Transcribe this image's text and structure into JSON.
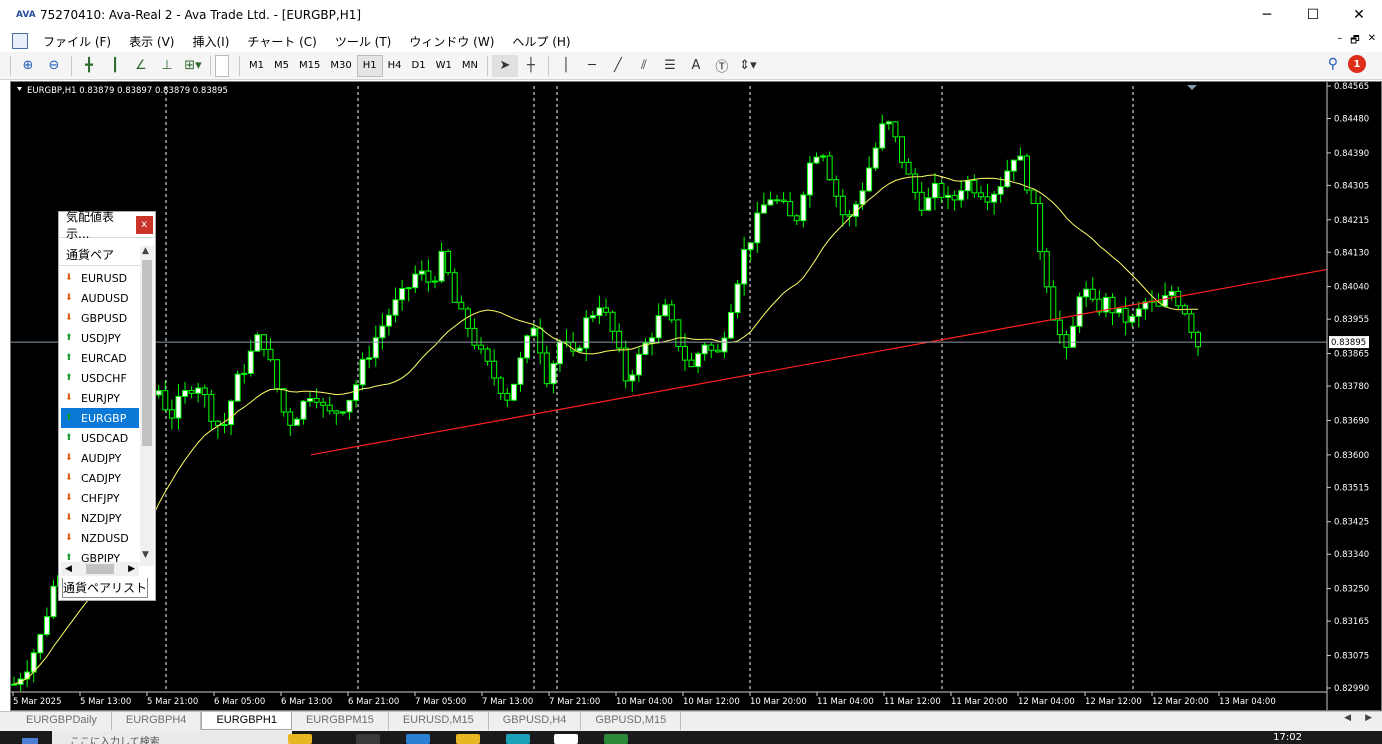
{
  "window": {
    "title": "75270410: Ava-Real 2 - Ava Trade Ltd. - [EURGBP,H1]",
    "logo": "AVA",
    "min": "─",
    "max": "☐",
    "close": "✕"
  },
  "menu": {
    "items": [
      "ファイル (F)",
      "表示 (V)",
      "挿入(I)",
      "チャート (C)",
      "ツール (T)",
      "ウィンドウ (W)",
      "ヘルプ (H)"
    ],
    "mdi": [
      "–",
      "🗗",
      "✕"
    ]
  },
  "toolbar": {
    "timeframes": [
      "M1",
      "M5",
      "M15",
      "M30",
      "H1",
      "H4",
      "D1",
      "W1",
      "MN"
    ],
    "active_timeframe": "H1",
    "tools": [
      "zoom-in-icon",
      "zoom-out-icon",
      "bar-chart-icon",
      "candle-icon",
      "line-chart-icon",
      "chart-shift-icon",
      "add-indicator-icon",
      "cursor-icon",
      "crosshair-icon",
      "vertical-line-icon",
      "horizontal-line-icon",
      "trend-line-icon",
      "fibo-channel-icon",
      "fibo-icon",
      "text-icon",
      "text-label-icon",
      "arrows-icon"
    ],
    "notification_count": "1"
  },
  "chart": {
    "header": "EURGBP,H1  0.83879 0.83897 0.83879 0.83895",
    "symbol": "EURGBP",
    "period": "H1",
    "current_price": "0.83895",
    "colors": {
      "background": "#000000",
      "bull": "#ffffff",
      "bear": "#000000",
      "wick": "#00ff00",
      "ma": "#ffff66",
      "trendline": "#ff0000",
      "grid_vertical": "#ffffff",
      "bid_line": "#8a9aa6"
    }
  },
  "chart_data": {
    "type": "candlestick",
    "title": "EURGBP,H1",
    "ylim": [
      0.8299,
      0.84565
    ],
    "y_ticks": [
      "0.84565",
      "0.84480",
      "0.84390",
      "0.84305",
      "0.84215",
      "0.84130",
      "0.84040",
      "0.83955",
      "0.83865",
      "0.83780",
      "0.83690",
      "0.83600",
      "0.83515",
      "0.83425",
      "0.83340",
      "0.83250",
      "0.83165",
      "0.83075",
      "0.82990"
    ],
    "x_ticks": [
      "5 Mar 2025",
      "5 Mar 13:00",
      "5 Mar 21:00",
      "6 Mar 05:00",
      "6 Mar 13:00",
      "6 Mar 21:00",
      "7 Mar 05:00",
      "7 Mar 13:00",
      "7 Mar 21:00",
      "10 Mar 04:00",
      "10 Mar 12:00",
      "10 Mar 20:00",
      "11 Mar 04:00",
      "11 Mar 12:00",
      "11 Mar 20:00",
      "12 Mar 04:00",
      "12 Mar 12:00",
      "12 Mar 20:00",
      "13 Mar 04:00"
    ],
    "close_path": [
      0.83,
      0.8305,
      0.8312,
      0.8325,
      0.8335,
      0.8342,
      0.8345,
      0.8352,
      0.836,
      0.8365,
      0.8372,
      0.8378,
      0.837,
      0.8375,
      0.838,
      0.8372,
      0.8366,
      0.8378,
      0.8385,
      0.8392,
      0.838,
      0.8368,
      0.8372,
      0.8378,
      0.837,
      0.8372,
      0.8376,
      0.8385,
      0.8392,
      0.8398,
      0.8402,
      0.8408,
      0.8405,
      0.8412,
      0.8398,
      0.8393,
      0.8385,
      0.838,
      0.8375,
      0.8385,
      0.8395,
      0.838,
      0.839,
      0.8385,
      0.8395,
      0.84,
      0.8392,
      0.838,
      0.8385,
      0.8392,
      0.8398,
      0.839,
      0.8382,
      0.839,
      0.8385,
      0.8398,
      0.8412,
      0.842,
      0.8428,
      0.8425,
      0.842,
      0.8435,
      0.8442,
      0.843,
      0.842,
      0.8428,
      0.8438,
      0.8448,
      0.844,
      0.843,
      0.8425,
      0.843,
      0.8425,
      0.8432,
      0.843,
      0.8428,
      0.8432,
      0.844,
      0.843,
      0.8412,
      0.8395,
      0.8385,
      0.8405,
      0.8398,
      0.84,
      0.8396,
      0.8395,
      0.84,
      0.8398,
      0.8403,
      0.8398,
      0.8389
    ],
    "moving_average": "yellow line",
    "trendline": {
      "from": {
        "x": "6 Mar 13:00",
        "y": 0.836
      },
      "to": {
        "x": "13 Mar 16:00",
        "y": 0.84085
      }
    }
  },
  "watch": {
    "title": "気配値表示...",
    "close": "x",
    "column": "通貨ペア",
    "tab": "通貨ペアリスト",
    "selected": "EURGBP",
    "items": [
      {
        "symbol": "EURUSD",
        "dir": "dn"
      },
      {
        "symbol": "AUDUSD",
        "dir": "dn"
      },
      {
        "symbol": "GBPUSD",
        "dir": "dn"
      },
      {
        "symbol": "USDJPY",
        "dir": "up"
      },
      {
        "symbol": "EURCAD",
        "dir": "up"
      },
      {
        "symbol": "USDCHF",
        "dir": "up"
      },
      {
        "symbol": "EURJPY",
        "dir": "dn"
      },
      {
        "symbol": "EURGBP",
        "dir": "up"
      },
      {
        "symbol": "USDCAD",
        "dir": "up"
      },
      {
        "symbol": "AUDJPY",
        "dir": "dn"
      },
      {
        "symbol": "CADJPY",
        "dir": "dn"
      },
      {
        "symbol": "CHFJPY",
        "dir": "dn"
      },
      {
        "symbol": "NZDJPY",
        "dir": "dn"
      },
      {
        "symbol": "NZDUSD",
        "dir": "dn"
      },
      {
        "symbol": "GBPJPY",
        "dir": "up"
      }
    ]
  },
  "tabs": {
    "items": [
      "EURGBPDaily",
      "EURGBPH4",
      "EURGBPH1",
      "EURGBPM15",
      "EURUSD,M15",
      "GBPUSD,H4",
      "GBPUSD,M15"
    ],
    "active": "EURGBPH1"
  },
  "taskbar": {
    "search_placeholder": "ここに入力して検索",
    "clock": "17:02"
  }
}
